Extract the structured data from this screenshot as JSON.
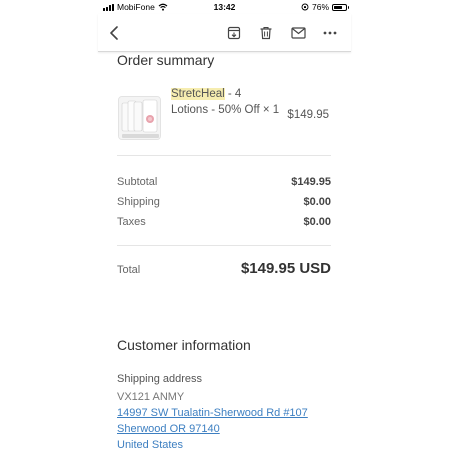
{
  "status_bar": {
    "carrier": "MobiFone",
    "time": "13:42",
    "battery": "76%",
    "battery_level": 0.76
  },
  "toolbar": {
    "back_icon": "chevron-left-icon",
    "archive_icon": "archive-download-icon",
    "delete_icon": "trash-icon",
    "mail_icon": "mail-icon",
    "more_icon": "more-horizontal-icon"
  },
  "order_summary": {
    "title": "Order summary",
    "product": {
      "name_highlight": "StretcHeal",
      "name_rest": " - 4 Lotions - 50% Off × 1",
      "price": "$149.95",
      "image_label": "BUY 4 GET 1 FREE"
    },
    "rows": [
      {
        "label": "Subtotal",
        "value": "$149.95"
      },
      {
        "label": "Shipping",
        "value": "$0.00"
      },
      {
        "label": "Taxes",
        "value": "$0.00"
      }
    ],
    "total_label": "Total",
    "total_value": "$149.95 USD"
  },
  "customer_info": {
    "title": "Customer information",
    "shipping_label": "Shipping address",
    "name": "VX121 ANMY",
    "address_line1": "14997 SW Tualatin-Sherwood Rd #107",
    "address_line2": "Sherwood OR 97140",
    "address_line3": "United States"
  }
}
